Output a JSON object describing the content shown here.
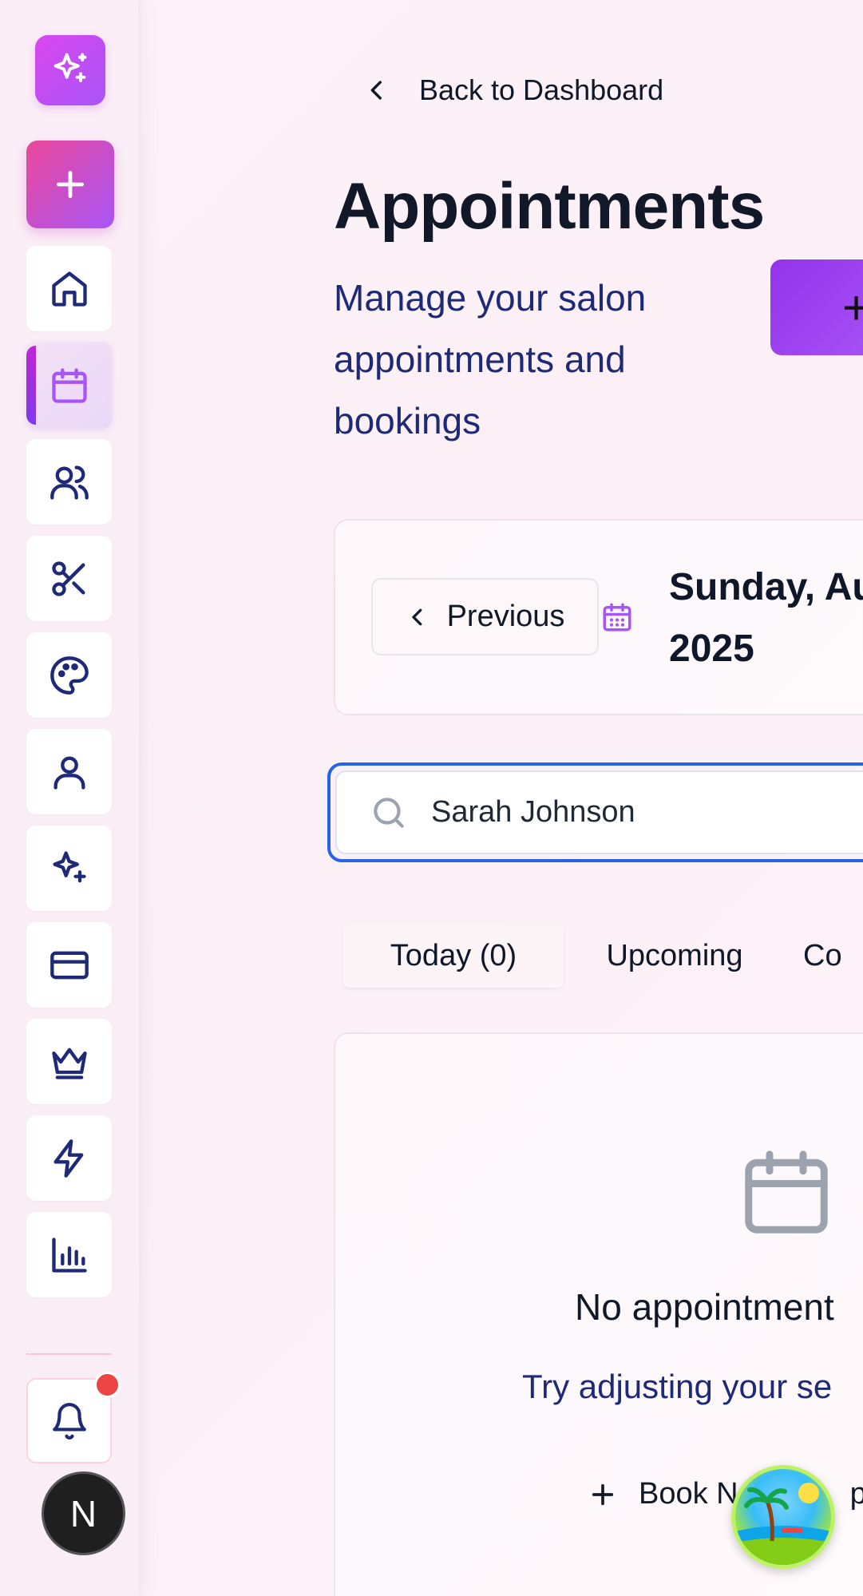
{
  "sidebar": {
    "logo_icon": "sparkles-icon",
    "add_icon": "plus-icon",
    "items": [
      {
        "name": "home",
        "icon": "home-icon"
      },
      {
        "name": "appointments",
        "icon": "calendar-icon",
        "active": true
      },
      {
        "name": "clients",
        "icon": "users-icon"
      },
      {
        "name": "services",
        "icon": "scissors-icon"
      },
      {
        "name": "styles",
        "icon": "palette-icon"
      },
      {
        "name": "staff",
        "icon": "user-icon"
      },
      {
        "name": "ai",
        "icon": "sparkles-icon"
      },
      {
        "name": "payments",
        "icon": "credit-card-icon"
      },
      {
        "name": "membership",
        "icon": "crown-icon"
      },
      {
        "name": "automations",
        "icon": "zap-icon"
      },
      {
        "name": "analytics",
        "icon": "bar-chart-icon"
      }
    ],
    "notifications_icon": "bell-icon",
    "avatar_letter": "N"
  },
  "header": {
    "back_label": "Back to Dashboard",
    "title": "Appointments",
    "subtitle": "Manage your salon appointments and bookings",
    "new_button_label": "+"
  },
  "date_nav": {
    "previous_label": "Previous",
    "date_label": "Sunday, Au",
    "year_label": "2025"
  },
  "search": {
    "value": "Sarah Johnson",
    "placeholder": ""
  },
  "tabs": [
    {
      "label": "Today (0)"
    },
    {
      "label": "Upcoming"
    },
    {
      "label": "Co"
    }
  ],
  "empty_state": {
    "title": "No appointment",
    "subtitle": "Try adjusting your se",
    "book_label": "Book N",
    "book_label_tail": "po"
  },
  "colors": {
    "accent": "#a855f7",
    "brand_pink": "#ec4899",
    "focus": "#2563eb",
    "alert": "#ef4444"
  }
}
